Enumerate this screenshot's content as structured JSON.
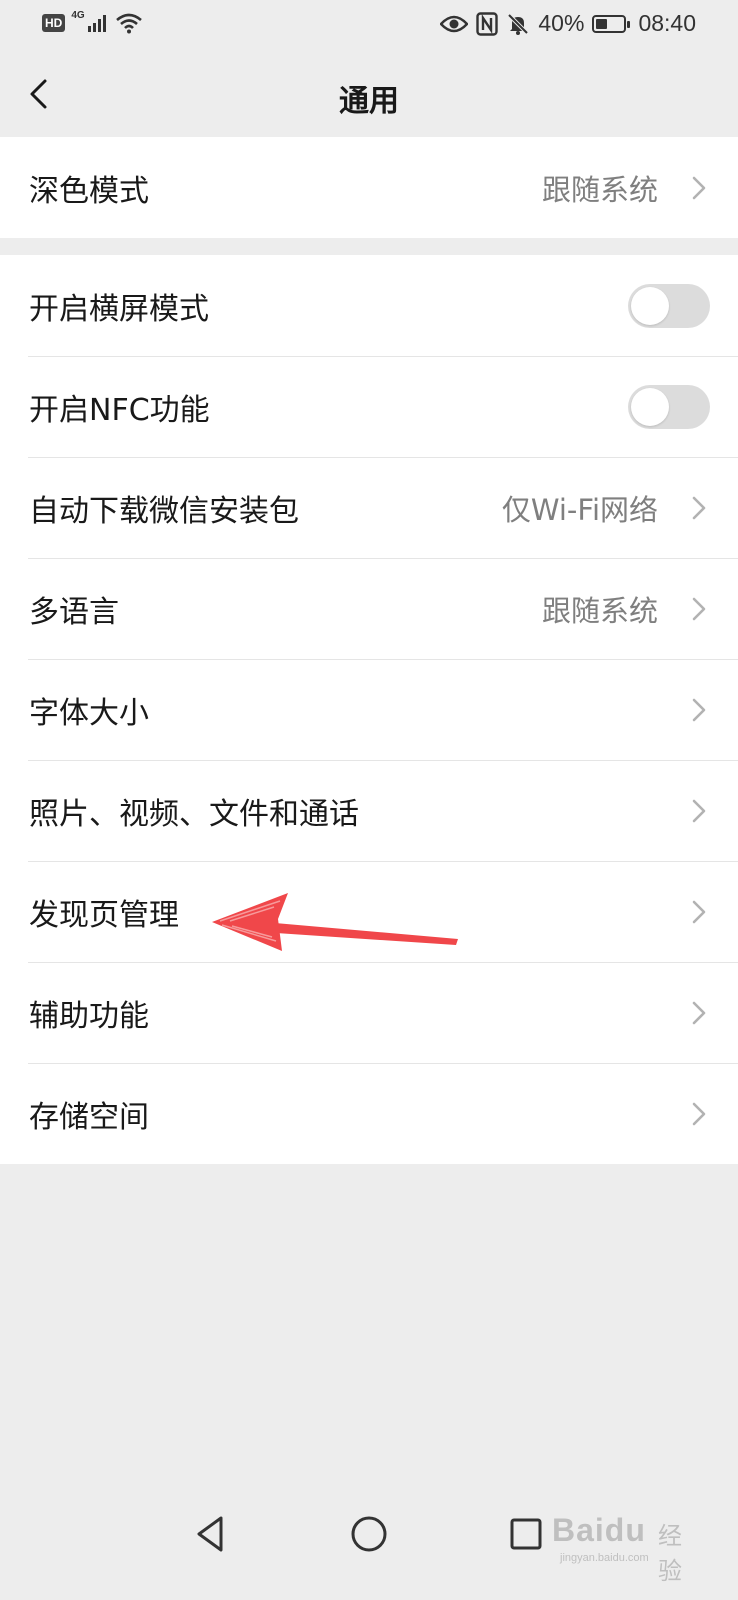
{
  "status_bar": {
    "hd_label": "HD",
    "network_label": "4G",
    "battery_text": "40%",
    "battery_level": 0.4,
    "time": "08:40"
  },
  "header": {
    "title": "通用"
  },
  "group1": {
    "dark_mode": {
      "label": "深色模式",
      "value": "跟随系统"
    }
  },
  "group2": {
    "landscape": {
      "label": "开启横屏模式",
      "enabled": false
    },
    "nfc": {
      "label": "开启NFC功能",
      "enabled": false
    },
    "auto_download": {
      "label": "自动下载微信安装包",
      "value": "仅Wi-Fi网络"
    },
    "language": {
      "label": "多语言",
      "value": "跟随系统"
    },
    "font_size": {
      "label": "字体大小"
    },
    "media": {
      "label": "照片、视频、文件和通话"
    },
    "discover": {
      "label": "发现页管理"
    },
    "accessibility": {
      "label": "辅助功能"
    },
    "storage": {
      "label": "存储空间"
    }
  },
  "colors": {
    "background": "#ededed",
    "card": "#ffffff",
    "annotation_arrow": "#f0474a"
  },
  "watermark": {
    "brand": "Baidu",
    "suffix": "经验",
    "url": "jingyan.baidu.com"
  }
}
